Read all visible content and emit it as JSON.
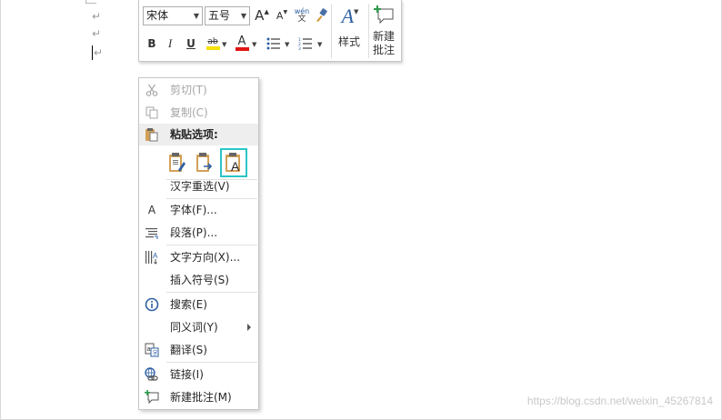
{
  "document": {
    "paragraph_mark": "↵"
  },
  "mini_toolbar": {
    "font_name": "宋体",
    "font_size": "五号",
    "grow_font_label": "A",
    "shrink_font_label": "A",
    "phonetic_top": "wén",
    "phonetic_bottom": "文",
    "bold_label": "B",
    "italic_label": "I",
    "underline_label": "U",
    "highlight_label": "ab",
    "font_color_label": "A",
    "styles_label": "样式",
    "new_comment_line1": "新建",
    "new_comment_line2": "批注",
    "highlight_color": "#f5e20a",
    "font_color": "#e11414",
    "accent_color": "#2e5fa3"
  },
  "context_menu": {
    "cut": "剪切(T)",
    "copy": "复制(C)",
    "paste_options": "粘贴选项:",
    "paste_buttons": [
      "keep-source-formatting",
      "merge-formatting",
      "keep-text-only"
    ],
    "reconvert": "汉字重选(V)",
    "font": "字体(F)...",
    "paragraph": "段落(P)...",
    "text_direction": "文字方向(X)...",
    "insert_symbol": "插入符号(S)",
    "search": "搜索(E)",
    "synonyms": "同义词(Y)",
    "translate": "翻译(S)",
    "link": "链接(I)",
    "new_comment": "新建批注(M)",
    "selection_color": "#2bc6c6"
  },
  "watermark": "https://blog.csdn.net/weixin_45267814"
}
